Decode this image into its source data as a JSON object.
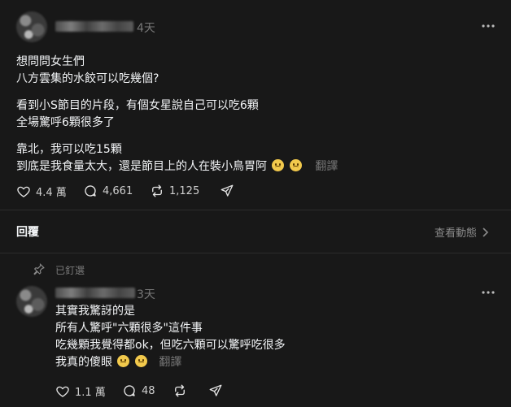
{
  "post": {
    "time": "4天",
    "lines_p1": [
      "想問問女生們",
      "八方雲集的水餃可以吃幾個?"
    ],
    "lines_p2": [
      "看到小S節目的片段，有個女星說自己可以吃6顆",
      "全場驚呼6顆很多了"
    ],
    "line_p3_1": "靠北，我可以吃15顆",
    "line_p3_2": "到底是我食量太大，還是節目上的人在裝小鳥胃阿",
    "translate": "翻譯",
    "likes": "4.4 萬",
    "comments": "4,661",
    "reposts": "1,125"
  },
  "replies_bar": {
    "title": "回覆",
    "activity": "查看動態"
  },
  "reply": {
    "pinned": "已釘選",
    "time": "3天",
    "line1": "其實我驚訝的是",
    "line2": "所有人驚呼\"六顆很多\"這件事",
    "line3": "吃幾顆我覺得都ok，但吃六顆可以驚呼吃很多",
    "line4": "我真的傻眼",
    "translate": "翻譯",
    "likes": "1.1 萬",
    "comments": "48"
  },
  "icons": {
    "more": "more-icon",
    "heart": "heart-icon",
    "comment": "comment-icon",
    "repost": "repost-icon",
    "share": "share-icon",
    "pin": "pin-icon",
    "chevron": "chevron-right-icon",
    "emoji": "frowning-face-icon"
  }
}
